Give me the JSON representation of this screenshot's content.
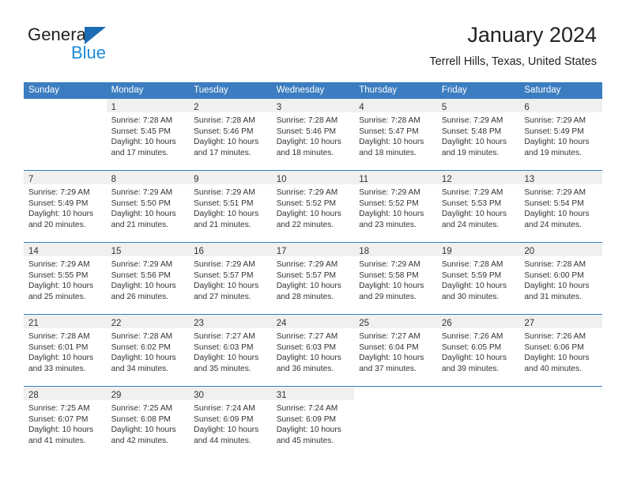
{
  "brand": {
    "name_part1": "General",
    "name_part2": "Blue",
    "logo_icon": "triangle-logo-icon"
  },
  "header": {
    "title": "January 2024",
    "subtitle": "Terrell Hills, Texas, United States"
  },
  "colors": {
    "header_blue": "#3b7dc0",
    "brand_dark": "#231f20",
    "brand_blue": "#1c8bd6",
    "daynum_bg": "#f0f0f0",
    "text": "#333333"
  },
  "weekday_headers": [
    "Sunday",
    "Monday",
    "Tuesday",
    "Wednesday",
    "Thursday",
    "Friday",
    "Saturday"
  ],
  "weeks": [
    [
      {
        "day": "",
        "sunrise": "",
        "sunset": "",
        "daylight1": "",
        "daylight2": "",
        "empty": true
      },
      {
        "day": "1",
        "sunrise": "Sunrise: 7:28 AM",
        "sunset": "Sunset: 5:45 PM",
        "daylight1": "Daylight: 10 hours",
        "daylight2": "and 17 minutes."
      },
      {
        "day": "2",
        "sunrise": "Sunrise: 7:28 AM",
        "sunset": "Sunset: 5:46 PM",
        "daylight1": "Daylight: 10 hours",
        "daylight2": "and 17 minutes."
      },
      {
        "day": "3",
        "sunrise": "Sunrise: 7:28 AM",
        "sunset": "Sunset: 5:46 PM",
        "daylight1": "Daylight: 10 hours",
        "daylight2": "and 18 minutes."
      },
      {
        "day": "4",
        "sunrise": "Sunrise: 7:28 AM",
        "sunset": "Sunset: 5:47 PM",
        "daylight1": "Daylight: 10 hours",
        "daylight2": "and 18 minutes."
      },
      {
        "day": "5",
        "sunrise": "Sunrise: 7:29 AM",
        "sunset": "Sunset: 5:48 PM",
        "daylight1": "Daylight: 10 hours",
        "daylight2": "and 19 minutes."
      },
      {
        "day": "6",
        "sunrise": "Sunrise: 7:29 AM",
        "sunset": "Sunset: 5:49 PM",
        "daylight1": "Daylight: 10 hours",
        "daylight2": "and 19 minutes."
      }
    ],
    [
      {
        "day": "7",
        "sunrise": "Sunrise: 7:29 AM",
        "sunset": "Sunset: 5:49 PM",
        "daylight1": "Daylight: 10 hours",
        "daylight2": "and 20 minutes."
      },
      {
        "day": "8",
        "sunrise": "Sunrise: 7:29 AM",
        "sunset": "Sunset: 5:50 PM",
        "daylight1": "Daylight: 10 hours",
        "daylight2": "and 21 minutes."
      },
      {
        "day": "9",
        "sunrise": "Sunrise: 7:29 AM",
        "sunset": "Sunset: 5:51 PM",
        "daylight1": "Daylight: 10 hours",
        "daylight2": "and 21 minutes."
      },
      {
        "day": "10",
        "sunrise": "Sunrise: 7:29 AM",
        "sunset": "Sunset: 5:52 PM",
        "daylight1": "Daylight: 10 hours",
        "daylight2": "and 22 minutes."
      },
      {
        "day": "11",
        "sunrise": "Sunrise: 7:29 AM",
        "sunset": "Sunset: 5:52 PM",
        "daylight1": "Daylight: 10 hours",
        "daylight2": "and 23 minutes."
      },
      {
        "day": "12",
        "sunrise": "Sunrise: 7:29 AM",
        "sunset": "Sunset: 5:53 PM",
        "daylight1": "Daylight: 10 hours",
        "daylight2": "and 24 minutes."
      },
      {
        "day": "13",
        "sunrise": "Sunrise: 7:29 AM",
        "sunset": "Sunset: 5:54 PM",
        "daylight1": "Daylight: 10 hours",
        "daylight2": "and 24 minutes."
      }
    ],
    [
      {
        "day": "14",
        "sunrise": "Sunrise: 7:29 AM",
        "sunset": "Sunset: 5:55 PM",
        "daylight1": "Daylight: 10 hours",
        "daylight2": "and 25 minutes."
      },
      {
        "day": "15",
        "sunrise": "Sunrise: 7:29 AM",
        "sunset": "Sunset: 5:56 PM",
        "daylight1": "Daylight: 10 hours",
        "daylight2": "and 26 minutes."
      },
      {
        "day": "16",
        "sunrise": "Sunrise: 7:29 AM",
        "sunset": "Sunset: 5:57 PM",
        "daylight1": "Daylight: 10 hours",
        "daylight2": "and 27 minutes."
      },
      {
        "day": "17",
        "sunrise": "Sunrise: 7:29 AM",
        "sunset": "Sunset: 5:57 PM",
        "daylight1": "Daylight: 10 hours",
        "daylight2": "and 28 minutes."
      },
      {
        "day": "18",
        "sunrise": "Sunrise: 7:29 AM",
        "sunset": "Sunset: 5:58 PM",
        "daylight1": "Daylight: 10 hours",
        "daylight2": "and 29 minutes."
      },
      {
        "day": "19",
        "sunrise": "Sunrise: 7:28 AM",
        "sunset": "Sunset: 5:59 PM",
        "daylight1": "Daylight: 10 hours",
        "daylight2": "and 30 minutes."
      },
      {
        "day": "20",
        "sunrise": "Sunrise: 7:28 AM",
        "sunset": "Sunset: 6:00 PM",
        "daylight1": "Daylight: 10 hours",
        "daylight2": "and 31 minutes."
      }
    ],
    [
      {
        "day": "21",
        "sunrise": "Sunrise: 7:28 AM",
        "sunset": "Sunset: 6:01 PM",
        "daylight1": "Daylight: 10 hours",
        "daylight2": "and 33 minutes."
      },
      {
        "day": "22",
        "sunrise": "Sunrise: 7:28 AM",
        "sunset": "Sunset: 6:02 PM",
        "daylight1": "Daylight: 10 hours",
        "daylight2": "and 34 minutes."
      },
      {
        "day": "23",
        "sunrise": "Sunrise: 7:27 AM",
        "sunset": "Sunset: 6:03 PM",
        "daylight1": "Daylight: 10 hours",
        "daylight2": "and 35 minutes."
      },
      {
        "day": "24",
        "sunrise": "Sunrise: 7:27 AM",
        "sunset": "Sunset: 6:03 PM",
        "daylight1": "Daylight: 10 hours",
        "daylight2": "and 36 minutes."
      },
      {
        "day": "25",
        "sunrise": "Sunrise: 7:27 AM",
        "sunset": "Sunset: 6:04 PM",
        "daylight1": "Daylight: 10 hours",
        "daylight2": "and 37 minutes."
      },
      {
        "day": "26",
        "sunrise": "Sunrise: 7:26 AM",
        "sunset": "Sunset: 6:05 PM",
        "daylight1": "Daylight: 10 hours",
        "daylight2": "and 39 minutes."
      },
      {
        "day": "27",
        "sunrise": "Sunrise: 7:26 AM",
        "sunset": "Sunset: 6:06 PM",
        "daylight1": "Daylight: 10 hours",
        "daylight2": "and 40 minutes."
      }
    ],
    [
      {
        "day": "28",
        "sunrise": "Sunrise: 7:25 AM",
        "sunset": "Sunset: 6:07 PM",
        "daylight1": "Daylight: 10 hours",
        "daylight2": "and 41 minutes."
      },
      {
        "day": "29",
        "sunrise": "Sunrise: 7:25 AM",
        "sunset": "Sunset: 6:08 PM",
        "daylight1": "Daylight: 10 hours",
        "daylight2": "and 42 minutes."
      },
      {
        "day": "30",
        "sunrise": "Sunrise: 7:24 AM",
        "sunset": "Sunset: 6:09 PM",
        "daylight1": "Daylight: 10 hours",
        "daylight2": "and 44 minutes."
      },
      {
        "day": "31",
        "sunrise": "Sunrise: 7:24 AM",
        "sunset": "Sunset: 6:09 PM",
        "daylight1": "Daylight: 10 hours",
        "daylight2": "and 45 minutes."
      },
      {
        "day": "",
        "sunrise": "",
        "sunset": "",
        "daylight1": "",
        "daylight2": "",
        "empty": true
      },
      {
        "day": "",
        "sunrise": "",
        "sunset": "",
        "daylight1": "",
        "daylight2": "",
        "empty": true
      },
      {
        "day": "",
        "sunrise": "",
        "sunset": "",
        "daylight1": "",
        "daylight2": "",
        "empty": true
      }
    ]
  ]
}
